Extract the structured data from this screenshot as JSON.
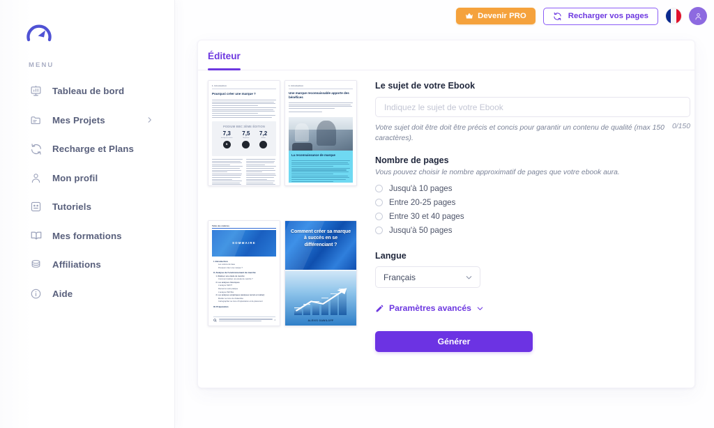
{
  "brand": {
    "logo_icon": "gauge-logo-icon",
    "accent": "#6d38e0"
  },
  "topbar": {
    "pro_button": {
      "label": "Devenir PRO",
      "icon": "crown-icon",
      "color": "#f5a23c"
    },
    "reload_button": {
      "label": "Recharger vos pages",
      "icon": "refresh-icon"
    },
    "language_flag": {
      "name": "france-flag-icon",
      "title": "Français"
    },
    "avatar": {
      "name": "user-avatar",
      "icon": "user-icon",
      "color": "#8d6ae0"
    }
  },
  "sidebar": {
    "section_label": "MENU",
    "items": [
      {
        "label": "Tableau de bord",
        "icon": "dashboard-chart-icon",
        "chevron": false
      },
      {
        "label": "Mes Projets",
        "icon": "folder-icon",
        "chevron": true,
        "chevron_icon": "chevron-right-icon"
      },
      {
        "label": "Recharge et Plans",
        "icon": "refresh-icon",
        "chevron": false
      },
      {
        "label": "Mon profil",
        "icon": "user-icon",
        "chevron": false
      },
      {
        "label": "Tutoriels",
        "icon": "card-text-icon",
        "chevron": false
      },
      {
        "label": "Mes formations",
        "icon": "open-book-icon",
        "chevron": false
      },
      {
        "label": "Affiliations",
        "icon": "coins-stack-icon",
        "chevron": false
      },
      {
        "label": "Aide",
        "icon": "info-circle-icon",
        "chevron": false
      }
    ]
  },
  "panel": {
    "tabs": [
      {
        "label": "Éditeur",
        "active": true
      }
    ]
  },
  "preview": {
    "pages": [
      {
        "header": "1. Introduction",
        "title": "Pourquoi créer une marque ?",
        "podium": {
          "title": "PODIUM BBC",
          "subtitle": "3ÈME ÉDITION",
          "scores": [
            {
              "value": "7,3",
              "caption": "Intelligence Extra",
              "badge": "B"
            },
            {
              "value": "7,5",
              "caption": "Moyenne",
              "badge": ""
            },
            {
              "value": "7,2",
              "caption": "Global",
              "badge": ""
            }
          ]
        }
      },
      {
        "header": "1. Introduction",
        "title": "Une marque reconnaissable apporte des bénéfices",
        "section_title": "La reconnaissance de marque"
      },
      {
        "header": "Table des matières",
        "banner": "SOMMAIRE",
        "entries": [
          {
            "level": 1,
            "text": "I. Introduction"
          },
          {
            "level": 2,
            "text": "Les notions de base"
          },
          {
            "level": 2,
            "text": "Pourquoi créer une marque ?"
          },
          {
            "level": 1,
            "text": "II. Analyse de l'environnement de marché"
          },
          {
            "level": 2,
            "text": "1. Réaliser une étude de marché"
          },
          {
            "level": 3,
            "text": "Comment réaliser une étude de marché ?"
          },
          {
            "level": 2,
            "text": "2. Les analyses théoriques"
          },
          {
            "level": 3,
            "text": "L'analyse SWOT"
          },
          {
            "level": 3,
            "text": "Recueil et outil pratique"
          },
          {
            "level": 3,
            "text": "L'analyse PESTEL"
          },
          {
            "level": 2,
            "text": "3. Les analyses empiriques (analyses terrain et métier)"
          },
          {
            "level": 3,
            "text": "Étudier sa zone de chalandise"
          },
          {
            "level": 3,
            "text": "Cartographier sa zone d'implantation et de placement"
          },
          {
            "level": 1,
            "text": "III. Préparation"
          }
        ],
        "page_number": "4"
      },
      {
        "cover_title": "Comment créer sa marque à succès en se différenciant ?",
        "author": "ALEXIS GAWILOFF"
      }
    ]
  },
  "form": {
    "subject": {
      "label": "Le sujet de votre Ebook",
      "placeholder": "Indiquez le sujet de votre Ebook",
      "value": "",
      "hint": "Votre sujet doit être doit être précis et concis pour garantir un contenu de qualité (max 150 caractères).",
      "counter": "0/150"
    },
    "pages": {
      "label": "Nombre de pages",
      "sub": "Vous pouvez choisir le nombre approximatif de pages que votre ebook aura.",
      "options": [
        {
          "label": "Jusqu'à 10 pages",
          "selected": false
        },
        {
          "label": "Entre 20-25 pages",
          "selected": false
        },
        {
          "label": "Entre 30 et 40 pages",
          "selected": false
        },
        {
          "label": "Jusqu'à 50 pages",
          "selected": false
        }
      ]
    },
    "language": {
      "label": "Langue",
      "value": "Français",
      "options": [
        "Français"
      ],
      "chevron_icon": "chevron-down-icon"
    },
    "advanced": {
      "label": "Paramètres avancés",
      "icon": "pencil-icon",
      "chevron_icon": "chevron-down-icon"
    },
    "generate_button": {
      "label": "Générer",
      "color": "#6c33e3"
    }
  }
}
